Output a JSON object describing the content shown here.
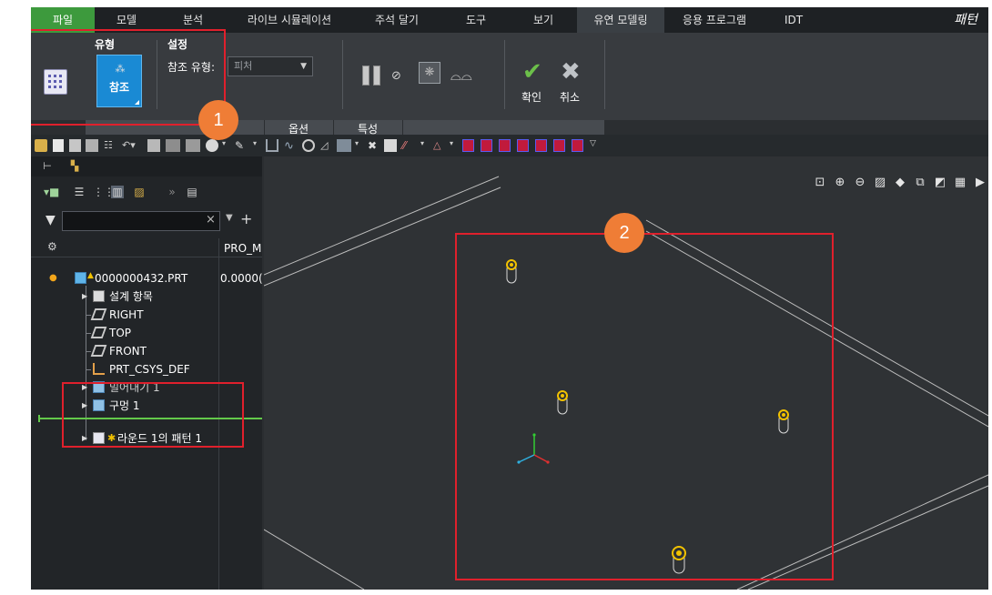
{
  "menu": {
    "items": [
      "파일",
      "모델",
      "분석",
      "라이브 시뮬레이션",
      "주석 달기",
      "도구",
      "보기",
      "유연 모델링",
      "응용 프로그램",
      "IDT"
    ],
    "title": "패턴"
  },
  "ribbon": {
    "type_group_label": "유형",
    "settings_group_label": "설정",
    "ref_button_label": "참조",
    "ref_type_label": "참조 유형:",
    "ref_type_value": "피처",
    "ok_label": "확인",
    "cancel_label": "취소",
    "footer_tabs": [
      "옵션",
      "특성"
    ]
  },
  "tree": {
    "column_header": "PRO_M",
    "items": [
      {
        "label": "0000000432.PRT",
        "value": "0.0000("
      },
      {
        "label": "설계 항목",
        "value": ""
      },
      {
        "label": "RIGHT",
        "value": ""
      },
      {
        "label": "TOP",
        "value": ""
      },
      {
        "label": "FRONT",
        "value": ""
      },
      {
        "label": "PRT_CSYS_DEF",
        "value": ""
      },
      {
        "label": "밀어내기 1",
        "value": ""
      },
      {
        "label": "구멍 1",
        "value": ""
      },
      {
        "label": "라운드 1의 패턴 1",
        "value": ""
      }
    ]
  },
  "callouts": [
    "1",
    "2"
  ],
  "colors": {
    "accent_green": "#3d9a3d",
    "selection_blue": "#1a8ad4",
    "highlight_red": "#e0202c",
    "callout_orange": "#ef7d36",
    "hole_yellow": "#f2c200"
  }
}
